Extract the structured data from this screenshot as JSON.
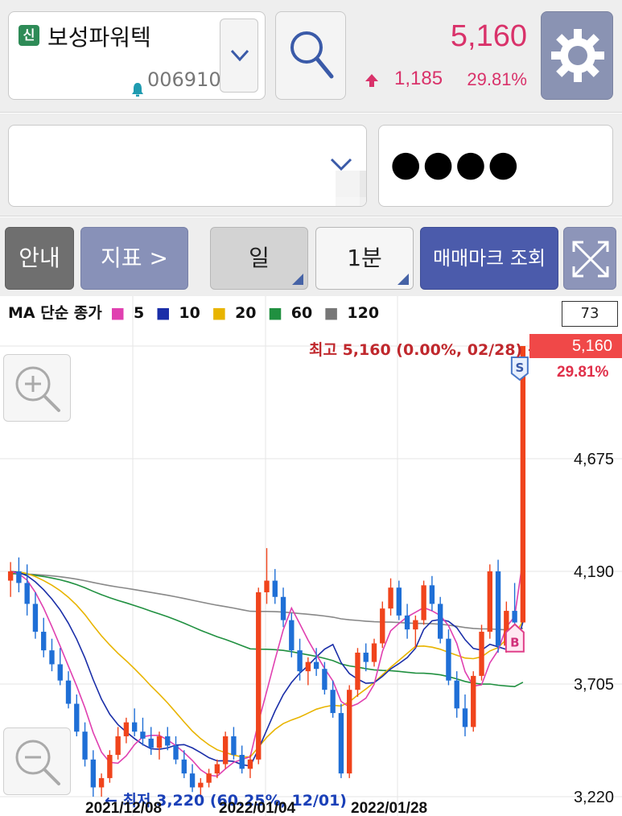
{
  "header": {
    "badge": "신",
    "stock_name": "보성파워텍",
    "stock_code": "006910",
    "price": "5,160",
    "change": "1,185",
    "change_rate": "29.81%",
    "colors": {
      "up": "#d9326a",
      "settings_bg": "#8a93b3"
    },
    "icons": [
      "alarm-icon",
      "chevron-down-icon",
      "search-icon",
      "up-arrow-icon",
      "gear-icon"
    ]
  },
  "account": {
    "password_masked": "●●●●"
  },
  "toolbar": {
    "info_label": "안내",
    "indicator_label": "지표 >",
    "period_label": "일",
    "interval_label": "1분",
    "trade_mark_label": "매매마크 조회"
  },
  "chart": {
    "legend": {
      "prefix": "MA 단순 종가",
      "items": [
        {
          "label": "5",
          "color": "#e040b0"
        },
        {
          "label": "10",
          "color": "#1a2ea8"
        },
        {
          "label": "20",
          "color": "#e8b400"
        },
        {
          "label": "60",
          "color": "#209040"
        },
        {
          "label": "120",
          "color": "#777777"
        }
      ]
    },
    "candle_count": "73",
    "current_price_tag": "5,160",
    "current_rate": "29.81%",
    "high_annotation": "최고 5,160 (0.00%, 02/28) →",
    "low_annotation": "← 최저 3,220 (60.25%, 12/01)",
    "y_ticks": [
      "4,675",
      "4,190",
      "3,705",
      "3,220"
    ],
    "x_ticks": [
      "2021/12/08",
      "2022/01/04",
      "2022/01/28"
    ],
    "sell_mark": "S",
    "buy_mark": "B"
  },
  "chart_data": {
    "type": "candlestick",
    "title": "",
    "xlabel": "",
    "ylabel": "",
    "ylim": [
      3220,
      5160
    ],
    "y_ticks": [
      3220,
      3705,
      4190,
      4675
    ],
    "x_ticks": [
      "2021/12/08",
      "2022/01/04",
      "2022/01/28"
    ],
    "high": {
      "value": 5160,
      "date": "02/28"
    },
    "low": {
      "value": 3220,
      "date": "12/01"
    },
    "candles": [
      [
        4150,
        4230,
        4080,
        4190
      ],
      [
        4190,
        4250,
        4100,
        4140
      ],
      [
        4140,
        4220,
        4000,
        4050
      ],
      [
        4050,
        4100,
        3900,
        3930
      ],
      [
        3930,
        3990,
        3820,
        3850
      ],
      [
        3850,
        3900,
        3760,
        3790
      ],
      [
        3790,
        3860,
        3700,
        3720
      ],
      [
        3720,
        3760,
        3600,
        3620
      ],
      [
        3620,
        3660,
        3480,
        3500
      ],
      [
        3500,
        3540,
        3350,
        3380
      ],
      [
        3380,
        3420,
        3220,
        3260
      ],
      [
        3260,
        3320,
        3220,
        3300
      ],
      [
        3300,
        3420,
        3280,
        3400
      ],
      [
        3400,
        3520,
        3380,
        3480
      ],
      [
        3480,
        3560,
        3450,
        3540
      ],
      [
        3540,
        3600,
        3480,
        3500
      ],
      [
        3500,
        3560,
        3440,
        3470
      ],
      [
        3470,
        3520,
        3400,
        3430
      ],
      [
        3430,
        3500,
        3380,
        3480
      ],
      [
        3480,
        3520,
        3420,
        3440
      ],
      [
        3440,
        3480,
        3360,
        3380
      ],
      [
        3380,
        3420,
        3300,
        3320
      ],
      [
        3320,
        3360,
        3240,
        3260
      ],
      [
        3260,
        3300,
        3220,
        3280
      ],
      [
        3280,
        3340,
        3260,
        3320
      ],
      [
        3320,
        3380,
        3300,
        3360
      ],
      [
        3360,
        3500,
        3340,
        3480
      ],
      [
        3480,
        3520,
        3380,
        3400
      ],
      [
        3400,
        3440,
        3320,
        3340
      ],
      [
        3340,
        3400,
        3300,
        3380
      ],
      [
        3380,
        4120,
        3360,
        4100
      ],
      [
        4100,
        4290,
        4050,
        4150
      ],
      [
        4150,
        4200,
        4050,
        4080
      ],
      [
        4080,
        4120,
        3950,
        3980
      ],
      [
        3980,
        4010,
        3820,
        3850
      ],
      [
        3850,
        3900,
        3720,
        3760
      ],
      [
        3760,
        3820,
        3700,
        3800
      ],
      [
        3800,
        3860,
        3740,
        3770
      ],
      [
        3770,
        3800,
        3660,
        3680
      ],
      [
        3680,
        3720,
        3560,
        3580
      ],
      [
        3580,
        3620,
        3300,
        3320
      ],
      [
        3320,
        3700,
        3300,
        3680
      ],
      [
        3680,
        3860,
        3650,
        3840
      ],
      [
        3840,
        3880,
        3760,
        3800
      ],
      [
        3800,
        3900,
        3780,
        3880
      ],
      [
        3880,
        4060,
        3860,
        4030
      ],
      [
        4030,
        4160,
        4000,
        4120
      ],
      [
        4120,
        4150,
        3980,
        4000
      ],
      [
        4000,
        4050,
        3900,
        3940
      ],
      [
        3940,
        4000,
        3860,
        3980
      ],
      [
        3980,
        4150,
        3960,
        4130
      ],
      [
        4130,
        4170,
        4020,
        4050
      ],
      [
        4050,
        4080,
        3880,
        3900
      ],
      [
        3900,
        3940,
        3700,
        3720
      ],
      [
        3720,
        3760,
        3560,
        3600
      ],
      [
        3600,
        3660,
        3480,
        3520
      ],
      [
        3520,
        3760,
        3500,
        3740
      ],
      [
        3740,
        3960,
        3720,
        3930
      ],
      [
        3930,
        4220,
        3900,
        4190
      ],
      [
        4190,
        4240,
        3840,
        3870
      ],
      [
        3870,
        4060,
        3840,
        4020
      ],
      [
        4020,
        4140,
        3960,
        3970
      ],
      [
        3970,
        5160,
        3970,
        5160
      ]
    ]
  }
}
